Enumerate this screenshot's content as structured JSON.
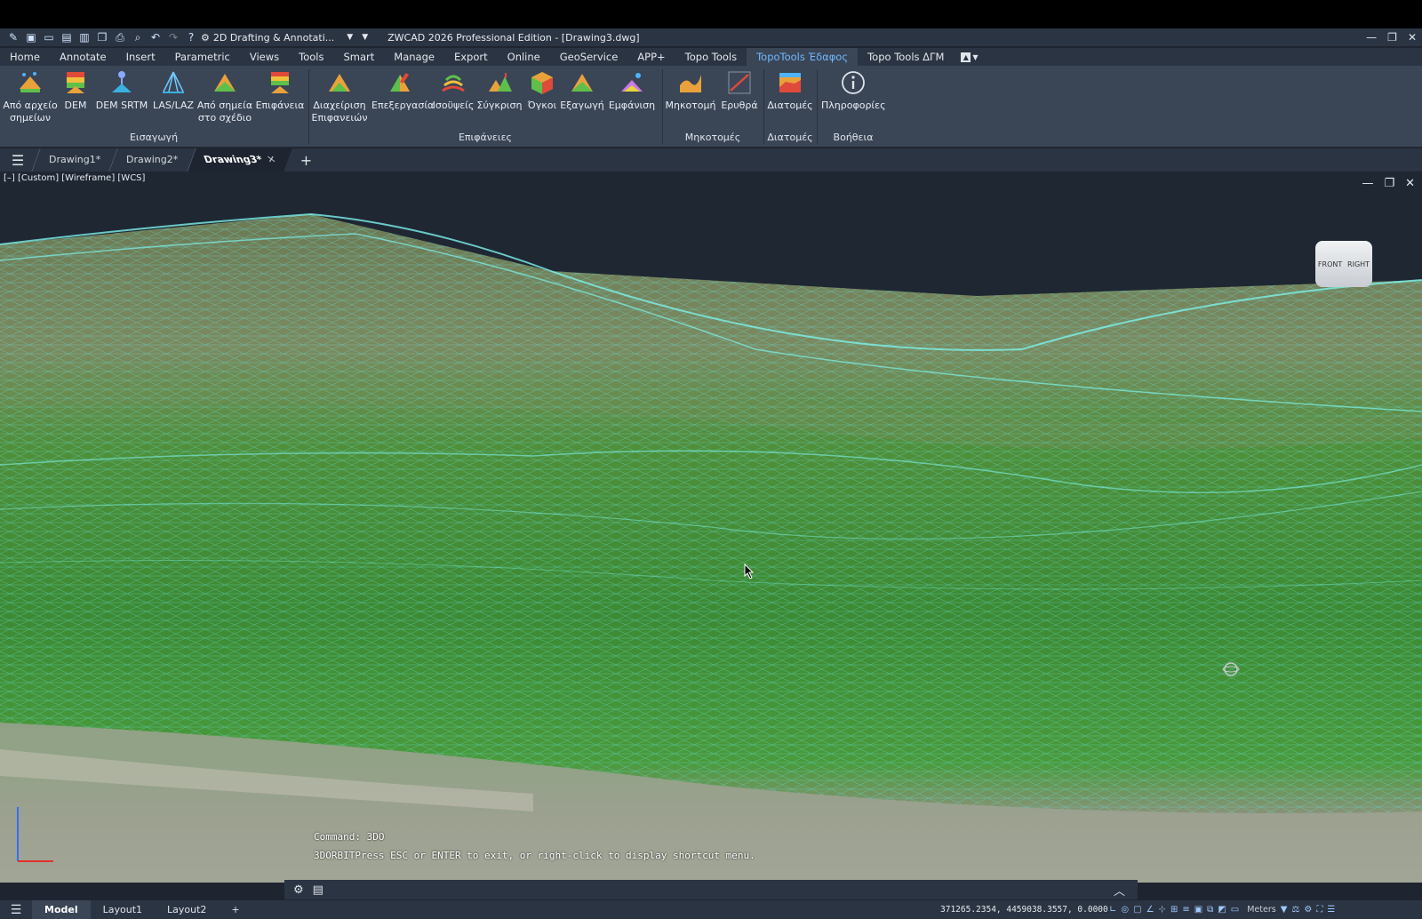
{
  "titlebar": {
    "workspace": "2D Drafting & Annotati...",
    "title": "ZWCAD 2026 Professional Edition - [Drawing3.dwg]"
  },
  "menu": {
    "tabs": [
      "Home",
      "Annotate",
      "Insert",
      "Parametric",
      "Views",
      "Tools",
      "Smart",
      "Manage",
      "Export",
      "Online",
      "GeoService",
      "APP+",
      "Topo Tools",
      "TopoTools Έδαφος",
      "Topo Tools ΔΓΜ"
    ],
    "active_index": 13
  },
  "ribbon": {
    "groups": [
      {
        "title": "Εισαγωγή",
        "buttons": [
          {
            "label1": "Από αρχείο",
            "label2": "σημείων",
            "icon": "points-file-icon"
          },
          {
            "label1": "DEM",
            "label2": "",
            "icon": "dem-icon"
          },
          {
            "label1": "DEM SRTM",
            "label2": "",
            "icon": "dem-srtm-icon"
          },
          {
            "label1": "LAS/LAZ",
            "label2": "",
            "icon": "las-laz-icon"
          },
          {
            "label1": "Από σημεία",
            "label2": "στο σχέδιο",
            "icon": "drawing-points-icon"
          },
          {
            "label1": "Επιφάνεια",
            "label2": "",
            "icon": "surface-icon"
          }
        ]
      },
      {
        "title": "Επιφάνειες",
        "buttons": [
          {
            "label1": "Διαχείριση",
            "label2": "Επιφανειών",
            "icon": "surface-manager-icon"
          },
          {
            "label1": "Επεξεργασία",
            "label2": "",
            "icon": "edit-surface-icon"
          },
          {
            "label1": "Ισοϋψείς",
            "label2": "",
            "icon": "contours-icon"
          },
          {
            "label1": "Σύγκριση",
            "label2": "",
            "icon": "compare-icon"
          },
          {
            "label1": "Όγκοι",
            "label2": "",
            "icon": "volumes-icon"
          },
          {
            "label1": "Εξαγωγή",
            "label2": "",
            "icon": "export-icon"
          },
          {
            "label1": "Εμφάνιση",
            "label2": "",
            "icon": "display-icon"
          }
        ]
      },
      {
        "title": "Μηκοτομές",
        "buttons": [
          {
            "label1": "Μηκοτομή",
            "label2": "",
            "icon": "profile-icon"
          },
          {
            "label1": "Ερυθρά",
            "label2": "",
            "icon": "red-line-icon"
          }
        ]
      },
      {
        "title": "Διατομές",
        "buttons": [
          {
            "label1": "Διατομές",
            "label2": "",
            "icon": "cross-sections-icon"
          }
        ]
      },
      {
        "title": "Βοήθεια",
        "buttons": [
          {
            "label1": "Πληροφορίες",
            "label2": "",
            "icon": "info-icon"
          }
        ]
      }
    ]
  },
  "doctabs": {
    "tabs": [
      {
        "label": "Drawing1*"
      },
      {
        "label": "Drawing2*"
      },
      {
        "label": "Drawing3*"
      }
    ],
    "active_index": 2,
    "close": "✕",
    "add": "+"
  },
  "viewport": {
    "label": "[–] [Custom] [Wireframe] [WCS]",
    "viewcube": {
      "front": "FRONT",
      "right": "RIGHT"
    },
    "command_line1": "Command: 3DO",
    "command_line2": "3DORBITPress ESC or ENTER to exit, or right-click to display shortcut menu."
  },
  "statusbar": {
    "layouts": [
      "Model",
      "Layout1",
      "Layout2"
    ],
    "add": "+",
    "coords": "371265.2354, 4459038.3557, 0.0000",
    "units": "Meters"
  },
  "colors": {
    "accent_tab": "#6fb8ff",
    "mesh": "#5ee8e0",
    "terrain_green": "#3f8f3a"
  }
}
